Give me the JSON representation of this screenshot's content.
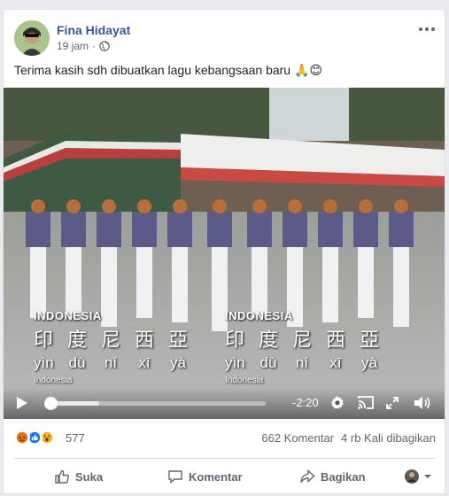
{
  "post": {
    "author": "Fina Hidayat",
    "time": "19 jam",
    "privacy_icon": "globe-icon",
    "text": "Terima kasih sdh dibuatkan lagu kebangsaan baru 🙏😊"
  },
  "video": {
    "caption_country": "INDONESIA",
    "caption_chars": [
      "印",
      "度",
      "尼",
      "西",
      "亞"
    ],
    "caption_pinyin": [
      "yìn",
      "dù",
      "ní",
      "xī",
      "yà"
    ],
    "caption_small": "Indonesia",
    "remaining_time": "-2:20",
    "progress": 0.02
  },
  "reactions": {
    "icons": [
      "angry-reaction-icon",
      "like-reaction-icon",
      "wow-reaction-icon"
    ],
    "count": "577",
    "comments": "662 Komentar",
    "shares": "4 rb Kali dibagikan"
  },
  "actions": {
    "like": "Suka",
    "comment": "Komentar",
    "share": "Bagikan"
  }
}
